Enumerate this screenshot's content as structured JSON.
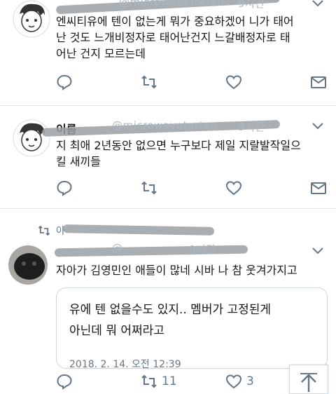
{
  "tweets": [
    {
      "handle": "@microwavetorten",
      "time": "9시간",
      "text_lines": [
        "엔씨티유에 텐이 없는게 뭐가 중요하겠어 니가 태어",
        "난 것도 느개비정자로 태어난건지 느갈배정자로 태",
        "어난 건지 모르는데"
      ]
    },
    {
      "name": "이름",
      "handle": "@microwavetorten",
      "time": "9시간",
      "text_lines": [
        "지 최애 2년동안 없으면 누구보다 제일 지랄발작일으",
        "킬 새끼들"
      ]
    },
    {
      "retweeted_by": "아",
      "handle": "@",
      "time": "9시간",
      "text": "자아가 김영민인 애들이 많네 시바 나 참 웃겨가지고",
      "quote": {
        "text_lines": [
          "유에 텐 없을수도 있지.. 멤버가 고정된게",
          "아닌데 뭐 어쩌라고"
        ],
        "date": "2018. 2. 14. 오전 12:39"
      },
      "retweets": "11",
      "likes": "3"
    }
  ],
  "colors": {
    "icon": "#657786",
    "divider": "#e1e8ed",
    "text": "#14171a",
    "muted": "#aab8c2"
  },
  "icons": [
    "reply-icon",
    "retweet-icon",
    "like-icon",
    "dm-icon",
    "chevron-down-icon",
    "scroll-top-icon"
  ]
}
